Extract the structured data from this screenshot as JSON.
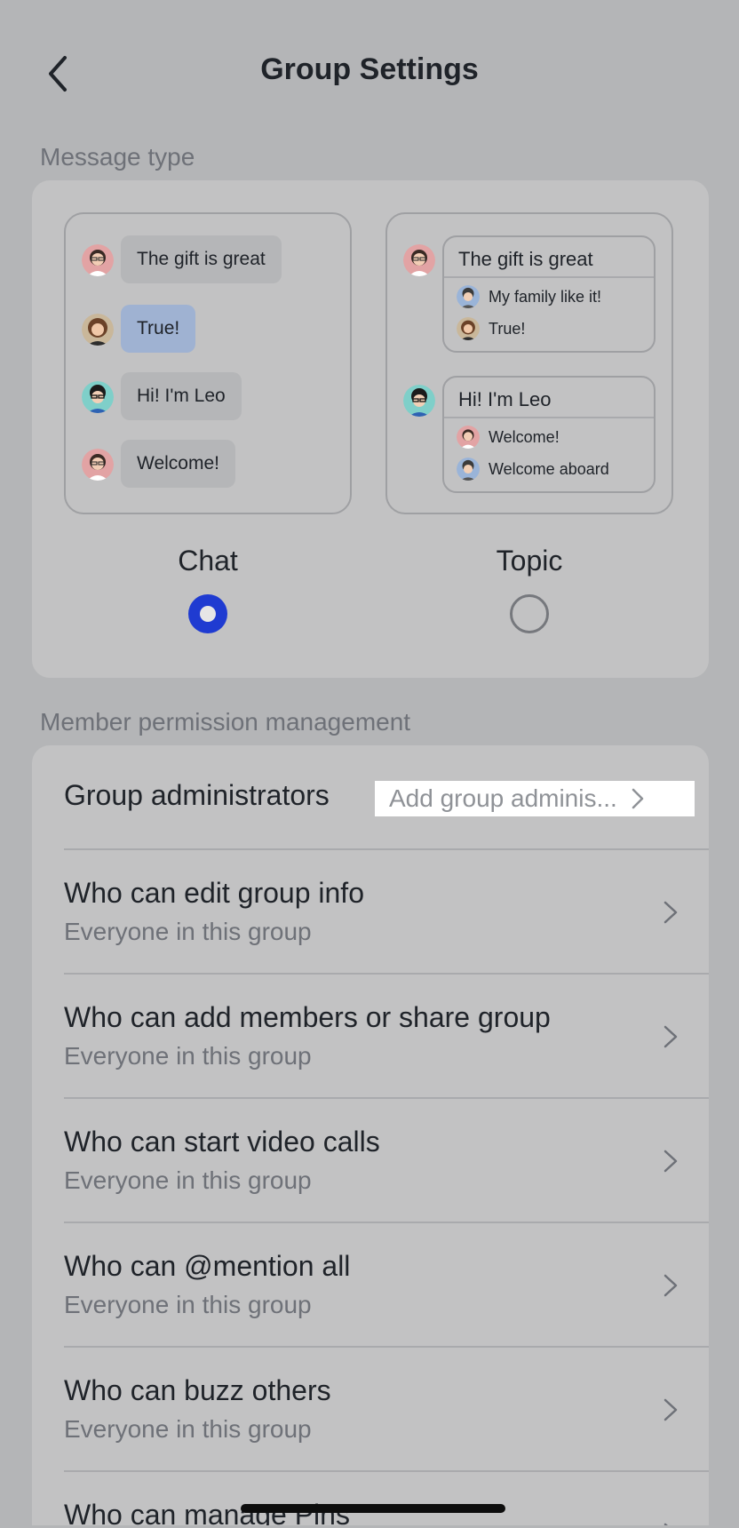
{
  "header": {
    "title": "Group Settings"
  },
  "message_type": {
    "section_label": "Message type",
    "chat_preview": [
      {
        "text": "The gift is great",
        "avatar": "woman-glasses-avatar"
      },
      {
        "text": "True!",
        "avatar": "woman-brown-hair-avatar",
        "highlight": true
      },
      {
        "text": "Hi! I'm Leo",
        "avatar": "man-glasses-avatar"
      },
      {
        "text": "Welcome!",
        "avatar": "woman-glasses-avatar"
      }
    ],
    "topic_preview": [
      {
        "head": "The gift is great",
        "replies": [
          "My family like it!",
          "True!"
        ]
      },
      {
        "head": "Hi! I'm Leo",
        "replies": [
          "Welcome!",
          "Welcome aboard"
        ]
      }
    ],
    "options": [
      {
        "label": "Chat",
        "selected": true
      },
      {
        "label": "Topic",
        "selected": false
      }
    ],
    "accent_color": "#1f3bd1"
  },
  "permissions": {
    "section_label": "Member permission management",
    "admin": {
      "title": "Group administrators",
      "value": "Add group adminis..."
    },
    "rows": [
      {
        "title": "Who can edit group info",
        "sub": "Everyone in this group"
      },
      {
        "title": "Who can add members or share group",
        "sub": "Everyone in this group"
      },
      {
        "title": "Who can start video calls",
        "sub": "Everyone in this group"
      },
      {
        "title": "Who can @mention all",
        "sub": "Everyone in this group"
      },
      {
        "title": "Who can buzz others",
        "sub": "Everyone in this group"
      },
      {
        "title": "Who can manage Pins",
        "sub": ""
      }
    ]
  }
}
